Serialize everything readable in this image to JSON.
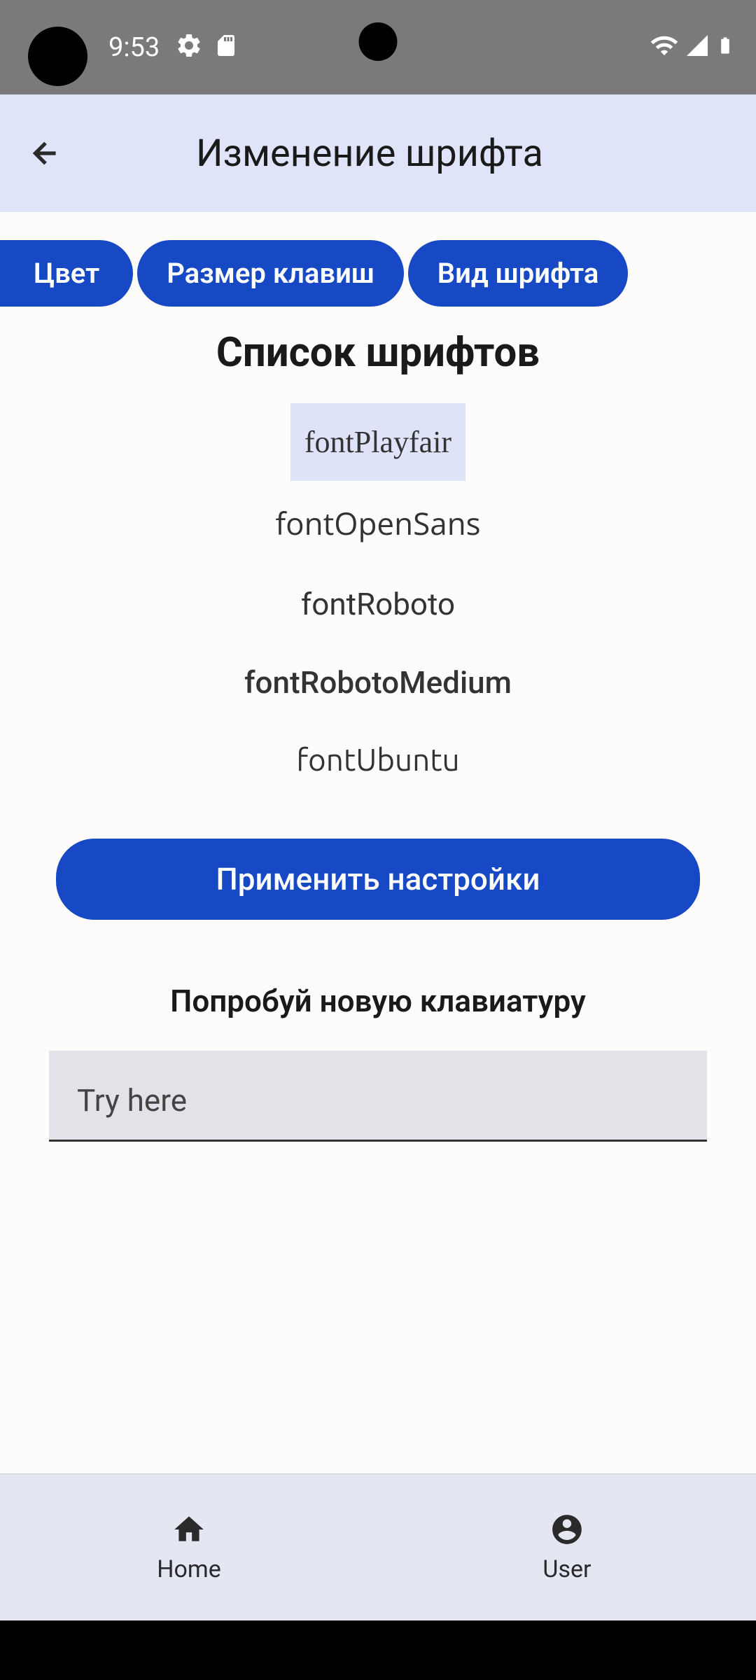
{
  "status": {
    "time": "9:53"
  },
  "header": {
    "title": "Изменение шрифта"
  },
  "tabs": [
    {
      "label": "Цвет"
    },
    {
      "label": "Размер клавиш"
    },
    {
      "label": "Вид шрифта"
    }
  ],
  "listTitle": "Список шрифтов",
  "fonts": [
    {
      "name": "fontPlayfair",
      "selected": true
    },
    {
      "name": "fontOpenSans",
      "selected": false
    },
    {
      "name": "fontRoboto",
      "selected": false
    },
    {
      "name": "fontRobotoMedium",
      "selected": false
    },
    {
      "name": "fontUbuntu",
      "selected": false
    }
  ],
  "applyLabel": "Применить настройки",
  "tryLabel": "Попробуй новую клавиатуру",
  "tryPlaceholder": "Try here",
  "bottomNav": [
    {
      "label": "Home"
    },
    {
      "label": "User"
    }
  ],
  "colors": {
    "primary": "#1749c5",
    "headerBg": "#e0e4f8",
    "selectedBg": "#dfe3f8",
    "navBg": "#e4e6f2"
  }
}
